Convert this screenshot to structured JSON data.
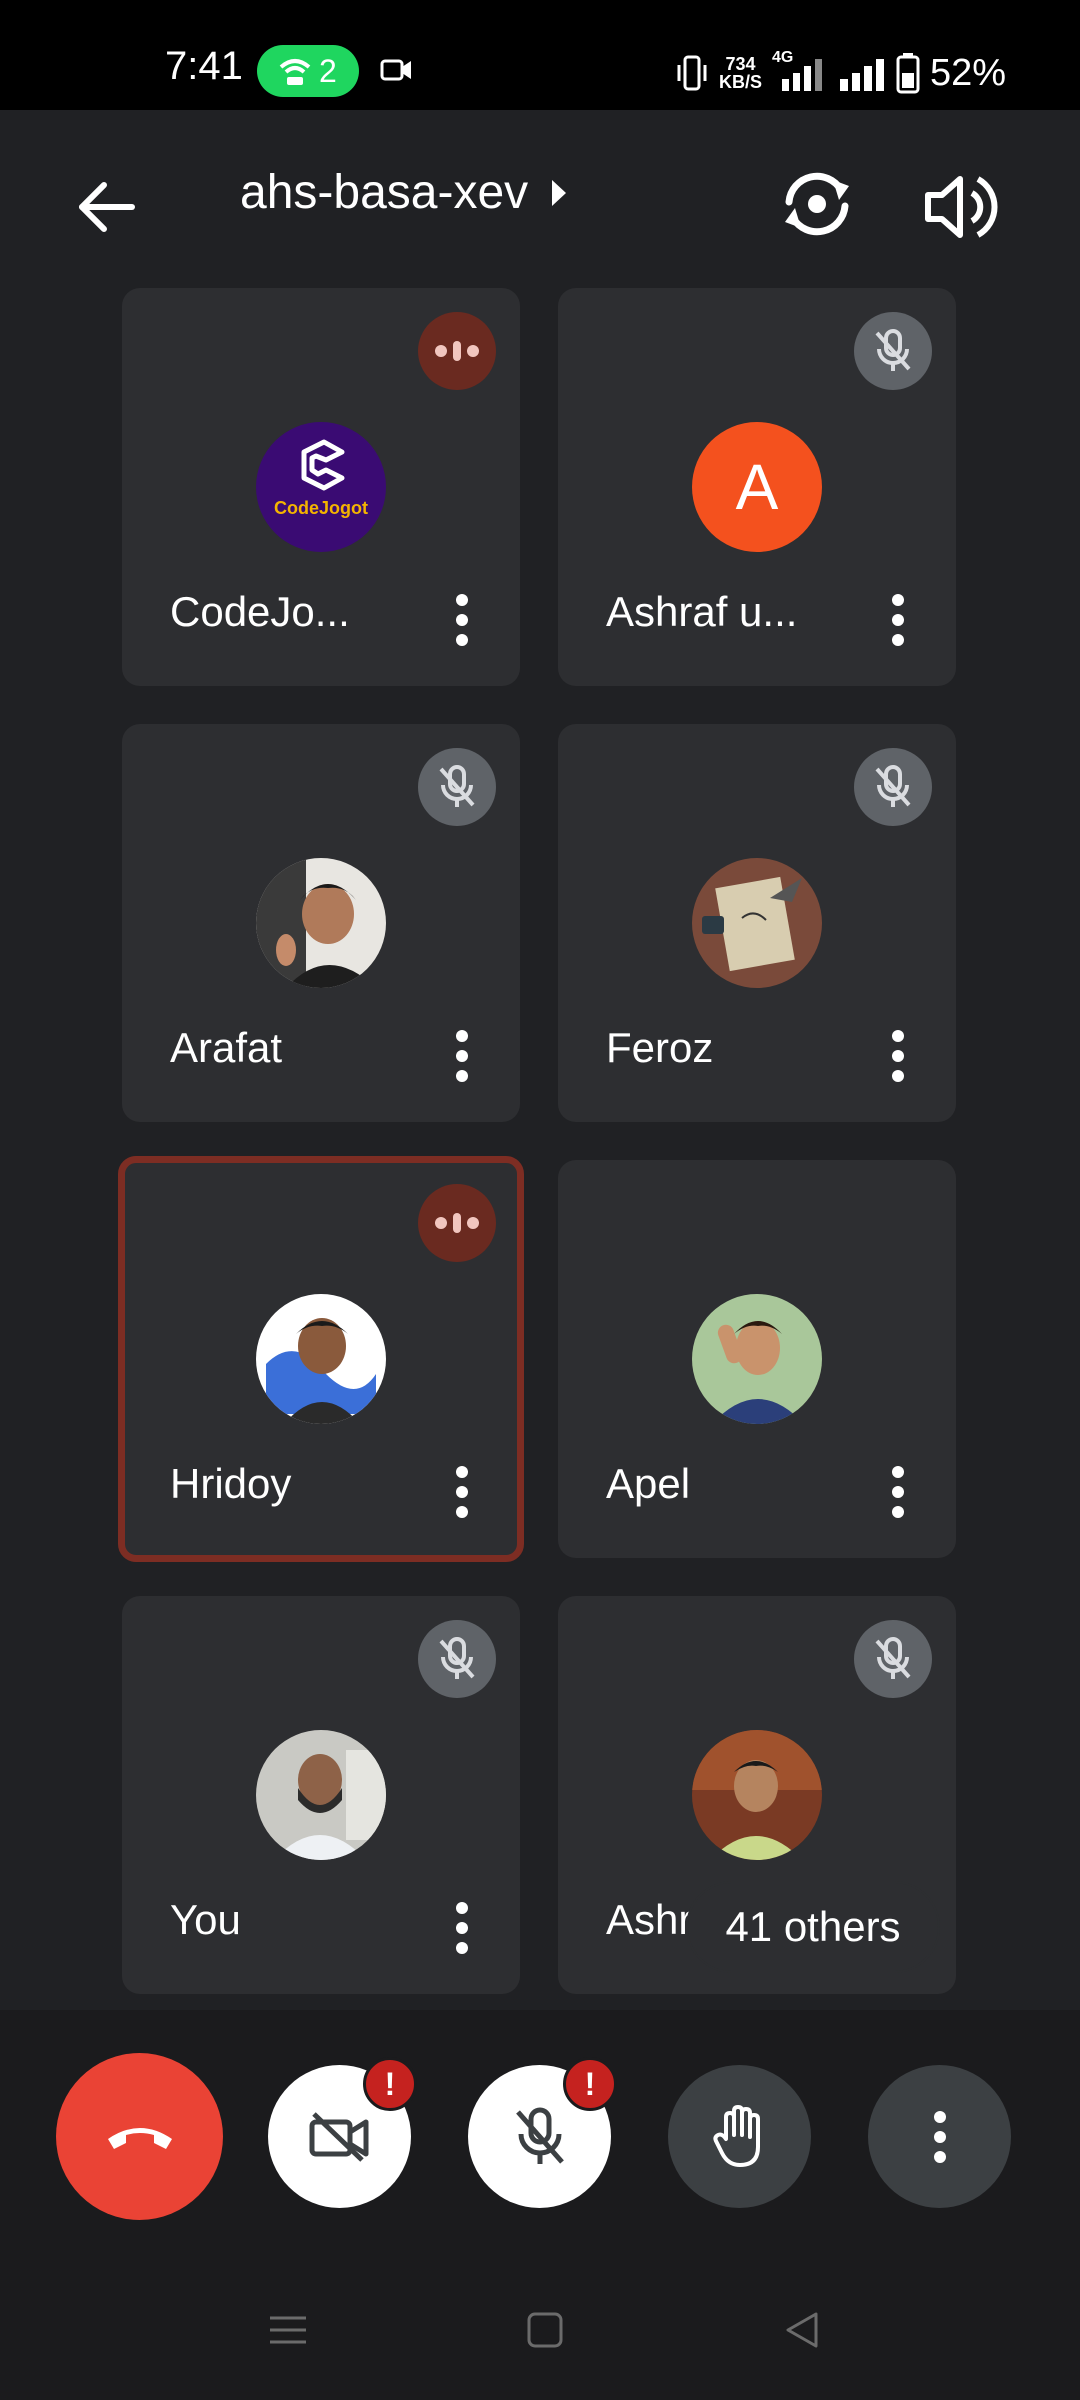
{
  "status_bar": {
    "time": "7:41",
    "hotspot_count": "2",
    "speed_value": "734",
    "speed_unit": "KB/S",
    "network": "4G",
    "battery": "52%"
  },
  "header": {
    "meeting_code": "ahs-basa-xev"
  },
  "participants": [
    {
      "name": "CodeJo...",
      "mic": "speaking",
      "avatar": "codejogot-logo",
      "logo_text": "CodeJogot"
    },
    {
      "name": "Ashraf u...",
      "mic": "muted",
      "avatar": "letter",
      "letter": "A",
      "avatar_color": "#f4511e"
    },
    {
      "name": "Arafat",
      "mic": "muted",
      "avatar": "photo"
    },
    {
      "name": "Feroz",
      "mic": "muted",
      "avatar": "photo"
    },
    {
      "name": "Hridoy",
      "mic": "speaking",
      "avatar": "photo",
      "active_speaker": true
    },
    {
      "name": "Apel",
      "mic": "none",
      "avatar": "photo"
    },
    {
      "name": "You",
      "mic": "muted",
      "avatar": "photo"
    },
    {
      "name": "Ashraful",
      "mic": "muted",
      "avatar": "photo"
    }
  ],
  "others_chip": "41 others",
  "controls": {
    "end_call_color": "#ea4335",
    "camera_alert": "!",
    "mic_alert": "!"
  }
}
